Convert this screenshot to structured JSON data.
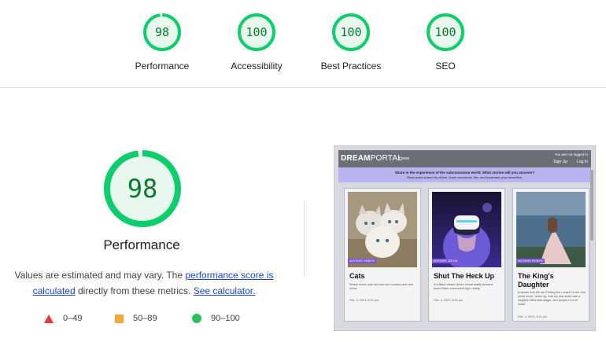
{
  "categories": [
    {
      "label": "Performance",
      "score": "98",
      "fraction": 0.98
    },
    {
      "label": "Accessibility",
      "score": "100",
      "fraction": 1.0
    },
    {
      "label": "Best Practices",
      "score": "100",
      "fraction": 1.0
    },
    {
      "label": "SEO",
      "score": "100",
      "fraction": 1.0
    }
  ],
  "main": {
    "score": "98",
    "fraction": 0.98,
    "title": "Performance",
    "desc_prefix": "Values are estimated and may vary. The ",
    "link_score": "performance score is calculated",
    "desc_middle": " directly from these metrics. ",
    "link_calc": "See calculator."
  },
  "legend": {
    "fail": "0–49",
    "average": "50–89",
    "pass": "90–100"
  },
  "colors": {
    "pass": "#0cce6b",
    "pass_bg": "#e8f8ee",
    "score_text": "#0a7a2f",
    "average": "#f4a83a",
    "fail": "#e53935",
    "link": "#1a47d6"
  },
  "preview": {
    "logo_bold": "DREAM",
    "logo_light": "PORTAL",
    "nav_home": "Home",
    "user_text": "You are not logged in",
    "signup": "Sign Up",
    "login": "Log In",
    "banner_line1": "Share in the experience of the subconscious world. What stories will you uncover?",
    "banner_line2": "Read posts shared by others, leave comments, like, and bookmark your favourites.",
    "cards": [
      {
        "tag": "AUTHOR: ROBYN",
        "title": "Cats",
        "body": "Where some cats can turn into humans and vice versa.",
        "date": "Feb. 4, 2023, 8:22 pm"
      },
      {
        "tag": "AUTHOR: ZELDA",
        "title": "Shut The Heck Up",
        "body": "A brilliant dream where virtual reality became tuned down convenient ego. reality.",
        "date": "Feb. 4, 2023, 8:52 pm"
      },
      {
        "tag": "AUTHOR: ROBYN",
        "title": "The King's Daughter",
        "body": "A dream that left me Feeling like I wasn't in the real world since I woke up, that my real world was a kingdom filled with magic, and people I'd ever loved",
        "date": "Feb. 4, 2023, 8:11 pm"
      }
    ]
  }
}
